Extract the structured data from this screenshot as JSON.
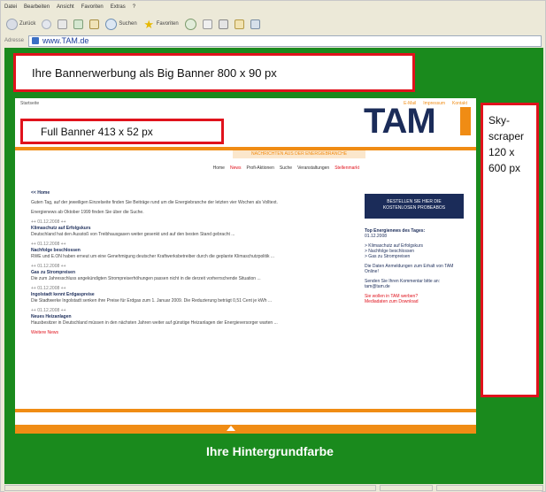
{
  "menu": [
    "Datei",
    "Bearbeiten",
    "Ansicht",
    "Favoriten",
    "Extras",
    "?"
  ],
  "toolbar": {
    "back_label": "Zurück",
    "search_label": "Suchen",
    "favorites_label": "Favoriten"
  },
  "address": {
    "label": "Adresse",
    "url": "www.TAM.de"
  },
  "big_banner": {
    "text": "Ihre Bannerwerbung als Big Banner 800 x 90 px"
  },
  "full_banner": {
    "text": "Full Banner 413 x 52 px"
  },
  "skyscraper": {
    "lines": [
      "Sky-",
      "scraper",
      "120 x",
      "600 px"
    ]
  },
  "background_text": "Ihre Hintergrundfarbe",
  "colors": {
    "background_green": "#1a8a1d",
    "banner_border_red": "#e0121c",
    "tam_orange": "#f08c14",
    "tam_navy": "#1b2c59"
  },
  "site": {
    "logo": "TAM",
    "top_link": "Startseite",
    "header_nav": [
      "E-Mail",
      "Impressum",
      "Kontakt"
    ],
    "slogan": "NACHRICHTEN AUS DER ENERGIEBRANCHE",
    "nav": [
      "Home",
      "News",
      "Profi-Aktionen",
      "Suche",
      "Veranstaltungen",
      "Stellenmarkt"
    ],
    "content": {
      "back": "<< Home",
      "intro": "Guten Tag, auf der jeweiligen Einzelseite finden Sie Beiträge rund um die Energiebranche der letzten vier Wochen als Volltext.",
      "archive": "Energienews ab Oktober 1999 finden Sie über die Suche.",
      "news": [
        {
          "date": "++ 01.12.2008 ++",
          "title": "Klimaschutz auf Erfolgskurs",
          "text": "Deutschland hat den Ausstoß von Treibhausgasen weiter gesenkt und auf den besten Stand gebracht ..."
        },
        {
          "date": "++ 01.12.2008 ++",
          "title": "Nachfolge beschlossen",
          "text": "RWE und E.ON haben erneut um eine Genehmigung deutscher Kraftwerksbetreiber durch die geplante Klimaschutzpolitik ..."
        },
        {
          "date": "++ 01.12.2008 ++",
          "title": "Gas zu Strompreisen",
          "text": "Die zum Jahresschluss angekündigten Strompreiserhöhungen passen nicht in die derzeit vorherrschende Situation ..."
        },
        {
          "date": "++ 01.12.2008 ++",
          "title": "Ingolstadt kennt Erdgaspreise",
          "text": "Die Stadtwerke Ingolstadt senken ihre Preise für Erdgas zum 1. Januar 2009. Die Reduzierung beträgt 0,51 Cent je kWh ..."
        },
        {
          "date": "++ 01.12.2008 ++",
          "title": "Neues Heizanlagen",
          "text": "Hausbesitzer in Deutschland müssen in den nächsten Jahren weiter auf günstige Heizanlagen der Energieversorger warten ..."
        }
      ],
      "more": "Weitere News"
    },
    "sidebar": {
      "box": [
        "BESTELLEN SIE HIER DIE",
        "KOSTENLOSEN PROBEABOS"
      ],
      "title": "Top Energienews des Tages:",
      "date": "01.12.2008",
      "items": [
        "> Klimaschutz auf Erfolgskurs",
        "> Nachfolge beschlossen",
        "> Gas zu Strompreisen"
      ],
      "note1": "Die Daten Anmeldungen zum Erhalt von TAM Online!",
      "note2": "Senden Sie Ihren Kommentar bitte an: tam@tam.de",
      "cta": "Sie wollen in TAM werben?",
      "cta2": "Mediadaten zum Download"
    }
  }
}
